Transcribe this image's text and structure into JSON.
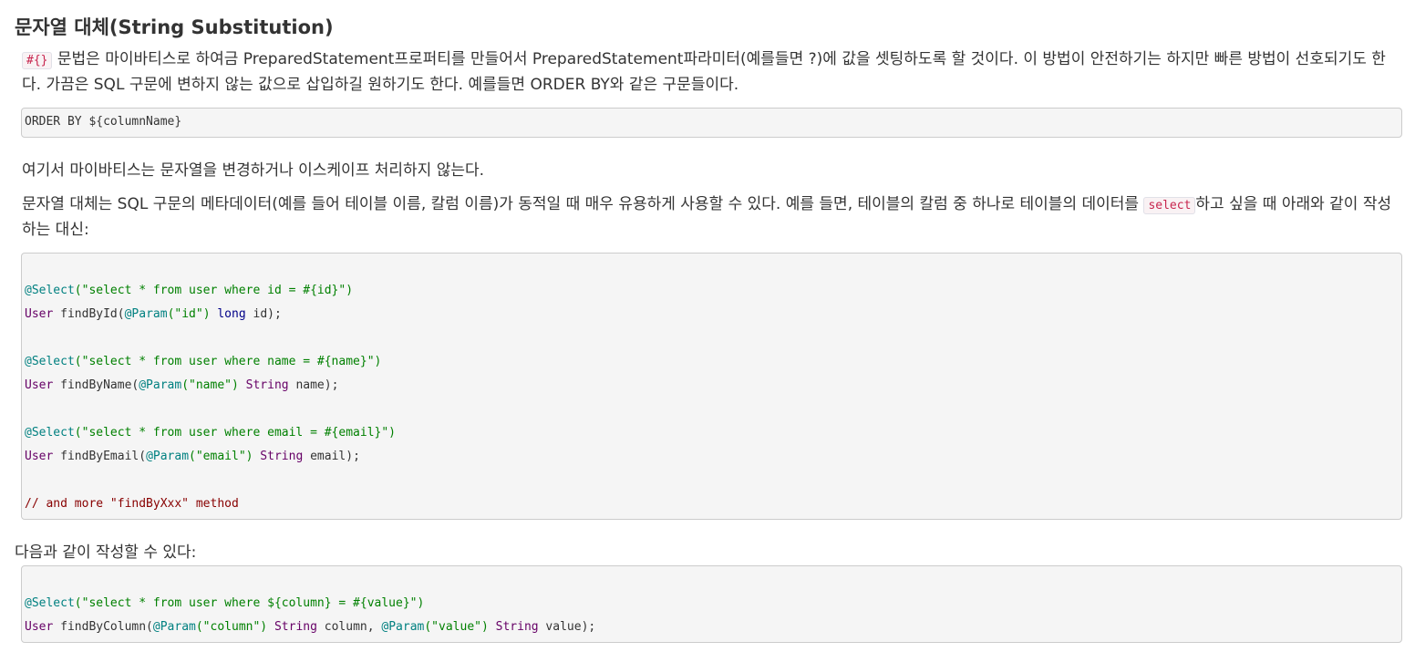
{
  "heading": "문자열 대체(String Substitution)",
  "para1": {
    "code": "#{}",
    "text": " 문법은 마이바티스로 하여금 PreparedStatement프로퍼티를 만들어서 PreparedStatement파라미터(예를들면 ?)에 값을 셋팅하도록 할 것이다. 이 방법이 안전하기는 하지만 빠른 방법이 선호되기도 한다. 가끔은 SQL 구문에 변하지 않는 값으로 삽입하길 원하기도 한다. 예를들면 ORDER BY와 같은 구문들이다."
  },
  "code1": "ORDER BY ${columnName}",
  "para2": "여기서 마이바티스는 문자열을 변경하거나 이스케이프 처리하지 않는다.",
  "para3": {
    "before": "문자열 대체는 SQL 구문의 메타데이터(예를 들어 테이블 이름, 칼럼 이름)가 동적일 때 매우 유용하게 사용할 수 있다. 예를 들면, 테이블의 칼럼 중 하나로 테이블의 데이터를 ",
    "code": "select",
    "after": "하고 싶을 때 아래와 같이 작성하는 대신:"
  },
  "code2": {
    "a1_ann": "@Select",
    "a1_str": "(\"select * from user where id = #{id}\")",
    "m1_type": "User",
    "m1_name": " findById(",
    "m1_ann": "@Param",
    "m1_str": "(\"id\")",
    "m1_kw": " long",
    "m1_rest": " id);",
    "a2_ann": "@Select",
    "a2_str": "(\"select * from user where name = #{name}\")",
    "m2_type": "User",
    "m2_name": " findByName(",
    "m2_ann": "@Param",
    "m2_str": "(\"name\")",
    "m2_type2": " String",
    "m2_rest": " name);",
    "a3_ann": "@Select",
    "a3_str": "(\"select * from user where email = #{email}\")",
    "m3_type": "User",
    "m3_name": " findByEmail(",
    "m3_ann": "@Param",
    "m3_str": "(\"email\")",
    "m3_type2": " String",
    "m3_rest": " email);",
    "comment": "// and more \"findByXxx\" method"
  },
  "para4": "다음과 같이 작성할 수 있다:",
  "code3": {
    "a_ann": "@Select",
    "a_str": "(\"select * from user where ${column} = #{value}\")",
    "m_type": "User",
    "m_name": " findByColumn(",
    "m_ann1": "@Param",
    "m_str1": "(\"column\")",
    "m_type2": " String",
    "m_mid": " column, ",
    "m_ann2": "@Param",
    "m_str2": "(\"value\")",
    "m_type3": " String",
    "m_rest": " value);"
  }
}
